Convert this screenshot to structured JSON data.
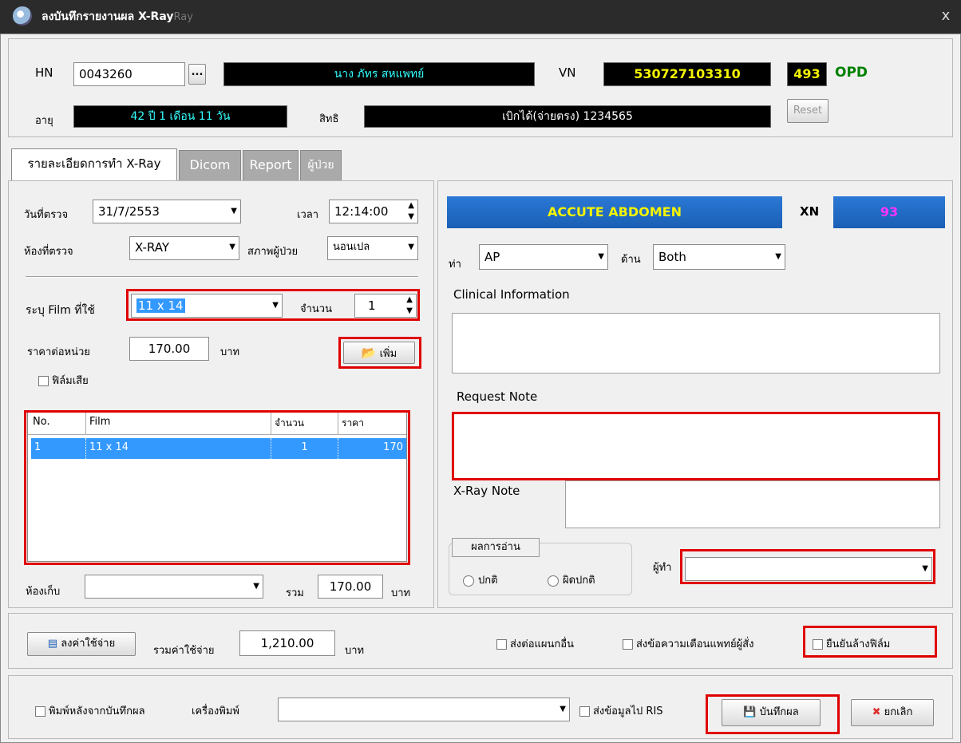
{
  "window": {
    "title": "ลงบันทึกรายงานผล X-Ray",
    "title_suffix": "Ray",
    "close": "x"
  },
  "header": {
    "hn_label": "HN",
    "hn": "0043260",
    "lookup_btn": "...",
    "patient_name": "นาง ภัทร สหแพทย์",
    "vn_label": "VN",
    "vn": "530727103310",
    "queue": "493",
    "visit_type": "OPD",
    "age_label": "อายุ",
    "age": "42 ปี 1 เดือน 11 วัน",
    "rights_label": "สิทธิ",
    "rights": "เบิกได้(จ่ายตรง) 1234565",
    "reset": "Reset"
  },
  "tabs": [
    "รายละเอียดการทำ X-Ray",
    "Dicom",
    "Report",
    "ผู้ป่วย"
  ],
  "left": {
    "date_label": "วันที่ตรวจ",
    "date": "31/7/2553",
    "time_label": "เวลา",
    "time": "12:14:00",
    "room_label": "ห้องที่ตรวจ",
    "room": "X-RAY",
    "patient_status_label": "สภาพผู้ป่วย",
    "patient_status": "นอนเปล",
    "film_label": "ระบุ Film ที่ใช้",
    "film": "11 x 14",
    "qty_label": "จำนวน",
    "qty": "1",
    "price_label": "ราคาต่อหน่วย",
    "price": "170.00",
    "baht": "บาท",
    "add_btn": "เพิ่ม",
    "bad_film": "ฟิล์มเสีย",
    "grid": {
      "headers": [
        "No.",
        "Film",
        "จำนวน",
        "ราคา"
      ],
      "rows": [
        [
          "1",
          "11 x 14",
          "1",
          "170"
        ]
      ]
    },
    "storage_label": "ห้องเก็บ",
    "storage": "",
    "total_label": "รวม",
    "total": "170.00",
    "total_baht": "บาท"
  },
  "right": {
    "exam": "ACCUTE ABDOMEN",
    "xn_label": "XN",
    "xn": "93",
    "position_label": "ท่า",
    "position": "AP",
    "side_label": "ด้าน",
    "side": "Both",
    "clinical_label": "Clinical Information",
    "request_label": "Request Note",
    "xray_note_label": "X-Ray Note",
    "result_group": "ผลการอ่าน",
    "normal": "ปกติ",
    "abnormal": "ผิดปกติ",
    "doer_label": "ผู้ทำ",
    "doer": ""
  },
  "cost": {
    "btn": "ลงค่าใช้จ่าย",
    "total_label": "รวมค่าใช้จ่าย",
    "total": "1,210.00",
    "baht": "บาท",
    "send_other": "ส่งต่อแผนกอื่น",
    "notify_doctor": "ส่งข้อความเตือนแพทย์ผู้สั่ง",
    "confirm_wash": "ยืนยันล้างฟิล์ม"
  },
  "bottom": {
    "print_after": "พิมพ์หลังจากบันทึกผล",
    "printer_label": "เครื่องพิมพ์",
    "printer": "",
    "send_ris": "ส่งข้อมูลไป RIS",
    "save": "บันทึกผล",
    "cancel": "ยกเลิก"
  },
  "colors": {
    "black_field": "#000000",
    "green_text": "#5de85d",
    "yellow_text": "#f4f400",
    "cyan_text": "#33ffff",
    "magenta_text": "#ff33ff",
    "exam_bg": "#1a5fb4",
    "highlight": "#e00000"
  }
}
